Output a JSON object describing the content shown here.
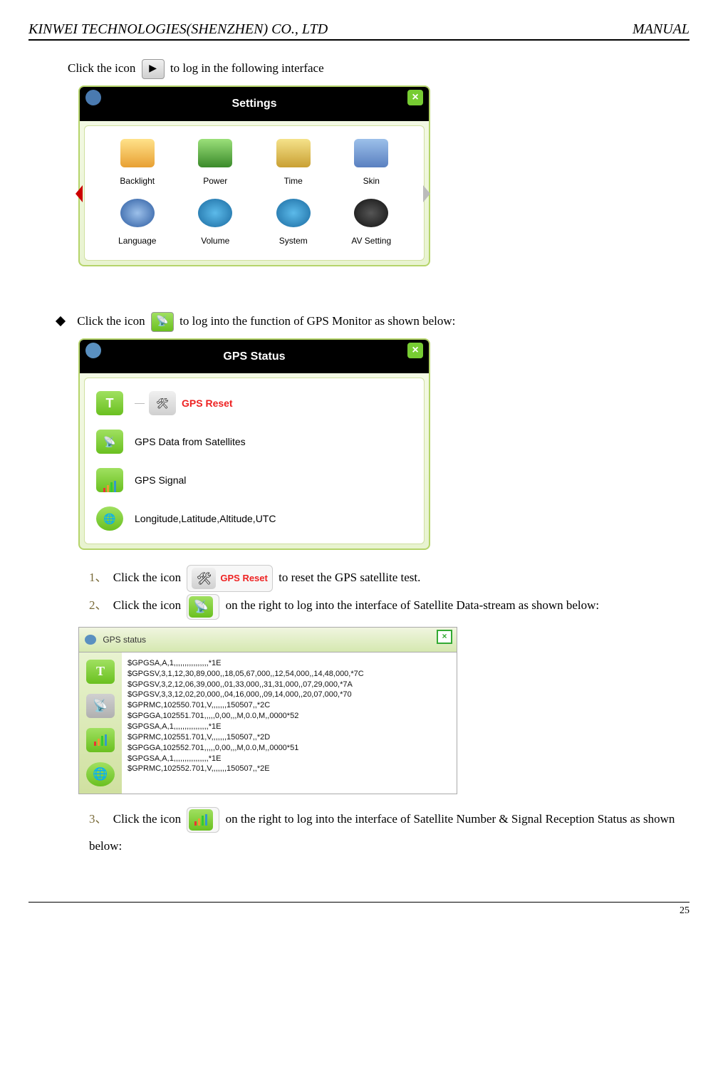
{
  "header": {
    "left": "KINWEI TECHNOLOGIES(SHENZHEN) CO., LTD",
    "right": "MANUAL"
  },
  "intro": {
    "line1_a": "Click the icon ",
    "line1_b": " to log in the following interface"
  },
  "settings": {
    "title": "Settings",
    "items": [
      "Backlight",
      "Power",
      "Time",
      "Skin",
      "Language",
      "Volume",
      "System",
      "AV Setting"
    ]
  },
  "bullet2": {
    "a": "Click the icon ",
    "b": " to log into the function of GPS Monitor as shown below:"
  },
  "gps_status": {
    "title": "GPS Status",
    "rows": [
      {
        "label": "GPS Reset",
        "red": true
      },
      {
        "label": "GPS Data from Satellites"
      },
      {
        "label": "GPS Signal"
      },
      {
        "label": "Longitude,Latitude,Altitude,UTC"
      }
    ]
  },
  "step1": {
    "num": "1、",
    "a": "Click the icon ",
    "btn": "GPS Reset",
    "b": " to reset the GPS satellite test."
  },
  "step2": {
    "num": "2、",
    "a": "Click the icon ",
    "b": " on the right to log into the interface of Satellite Data-stream as shown below:"
  },
  "datastream": {
    "title": "GPS status",
    "lines": "$GPGSA,A,1,,,,,,,,,,,,,,,,*1E\n$GPGSV,3,1,12,30,89,000,,18,05,67,000,,12,54,000,,14,48,000,*7C\n$GPGSV,3,2,12,06,39,000,,01,33,000,,31,31,000,,07,29,000,*7A\n$GPGSV,3,3,12,02,20,000,,04,16,000,,09,14,000,,20,07,000,*70\n$GPRMC,102550.701,V,,,,,,,150507,,*2C\n$GPGGA,102551.701,,,,,0,00,,,M,0.0,M,,0000*52\n$GPGSA,A,1,,,,,,,,,,,,,,,,*1E\n$GPRMC,102551.701,V,,,,,,,150507,,*2D\n$GPGGA,102552.701,,,,,0,00,,,M,0.0,M,,0000*51\n$GPGSA,A,1,,,,,,,,,,,,,,,,*1E\n$GPRMC,102552.701,V,,,,,,,150507,,*2E"
  },
  "step3": {
    "num": "3、",
    "a": "Click the icon ",
    "b": " on the right to log into the interface of Satellite Number & Signal Reception Status as shown below:"
  },
  "footer": {
    "page": "25"
  }
}
